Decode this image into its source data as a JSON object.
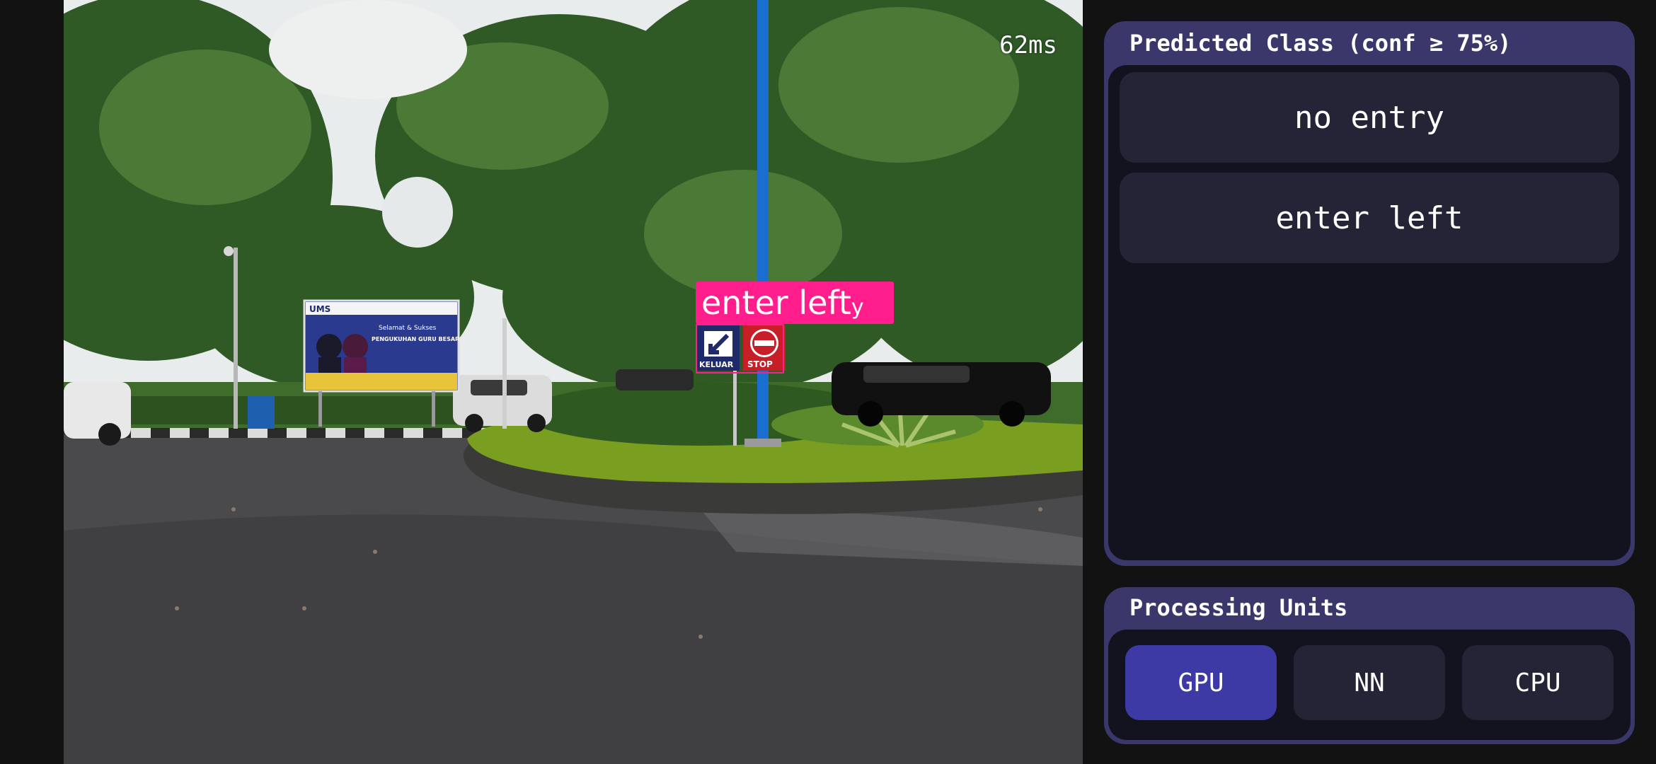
{
  "camera": {
    "latency": "62ms",
    "detection": {
      "label": "enter left",
      "label_suffix": "y"
    },
    "billboard": {
      "logo": "UMS",
      "line1": "Selamat & Sukses",
      "line2": "PENGUKUHAN GURU BESAR"
    },
    "signs": {
      "keluar": "KELUAR",
      "stop": "STOP"
    }
  },
  "prediction_panel": {
    "title": "Predicted Class (conf ≥ 75%)",
    "items": [
      "no entry",
      "enter left"
    ]
  },
  "units_panel": {
    "title": "Processing Units",
    "buttons": [
      "GPU",
      "NN",
      "CPU"
    ],
    "active": "GPU"
  },
  "colors": {
    "accent": "#3d3aa6",
    "panel": "#3a376a",
    "detection": "#ff1e8c"
  }
}
